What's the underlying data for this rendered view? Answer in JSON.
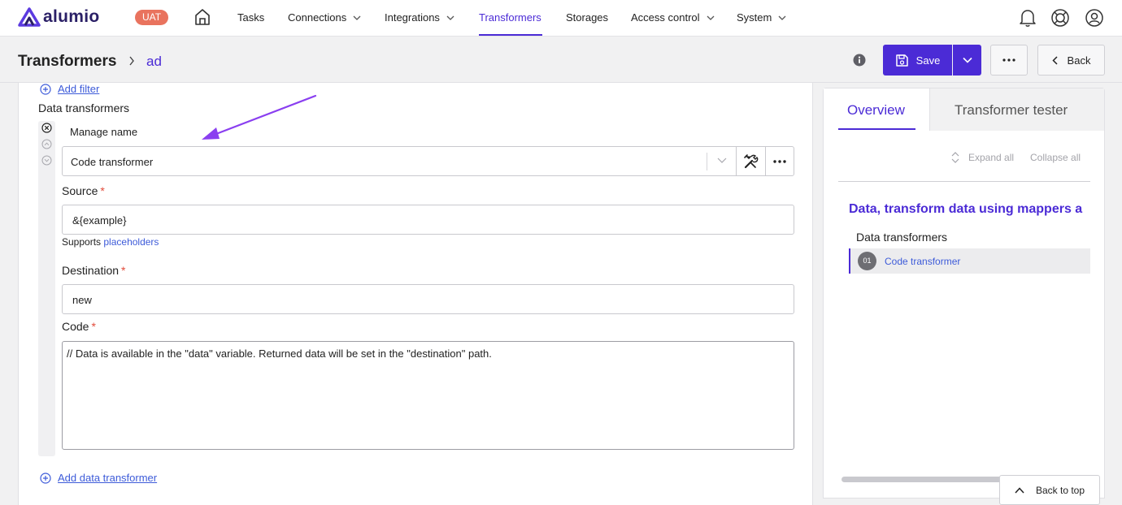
{
  "app": {
    "brand": "alumio",
    "env_badge": "UAT"
  },
  "nav": {
    "items": [
      {
        "label": "Tasks"
      },
      {
        "label": "Connections"
      },
      {
        "label": "Integrations"
      },
      {
        "label": "Transformers"
      },
      {
        "label": "Storages"
      },
      {
        "label": "Access control"
      },
      {
        "label": "System"
      }
    ],
    "active": "Transformers"
  },
  "header": {
    "title": "Transformers",
    "breadcrumb_current": "ad",
    "save_label": "Save",
    "back_label": "Back"
  },
  "editor": {
    "add_filter": "Add filter",
    "section_label": "Data transformers",
    "manage_name_label": "Manage name",
    "transformer_select_value": "Code transformer",
    "source": {
      "label": "Source",
      "required": "*",
      "value": "&{example}"
    },
    "helper_prefix": "Supports",
    "helper_link": "placeholders",
    "destination": {
      "label": "Destination",
      "required": "*",
      "value": "new"
    },
    "code": {
      "label": "Code",
      "required": "*",
      "value": "// Data is available in the \"data\" variable. Returned data will be set in the \"destination\" path."
    },
    "add_data_transformer": "Add data transformer"
  },
  "overview": {
    "tabs": [
      {
        "label": "Overview"
      },
      {
        "label": "Transformer tester"
      }
    ],
    "expand_all": "Expand all",
    "collapse_all": "Collapse all",
    "title": "Data, transform data using mappers a",
    "subtitle": "Data transformers",
    "items": [
      {
        "num": "01",
        "label": "Code transformer"
      }
    ]
  },
  "footer": {
    "back_to_top": "Back to top"
  },
  "colors": {
    "accent": "#4b2bd6",
    "badge": "#e9735e",
    "link": "#3d5bd9",
    "annotation_arrow": "#8a3ff0"
  }
}
